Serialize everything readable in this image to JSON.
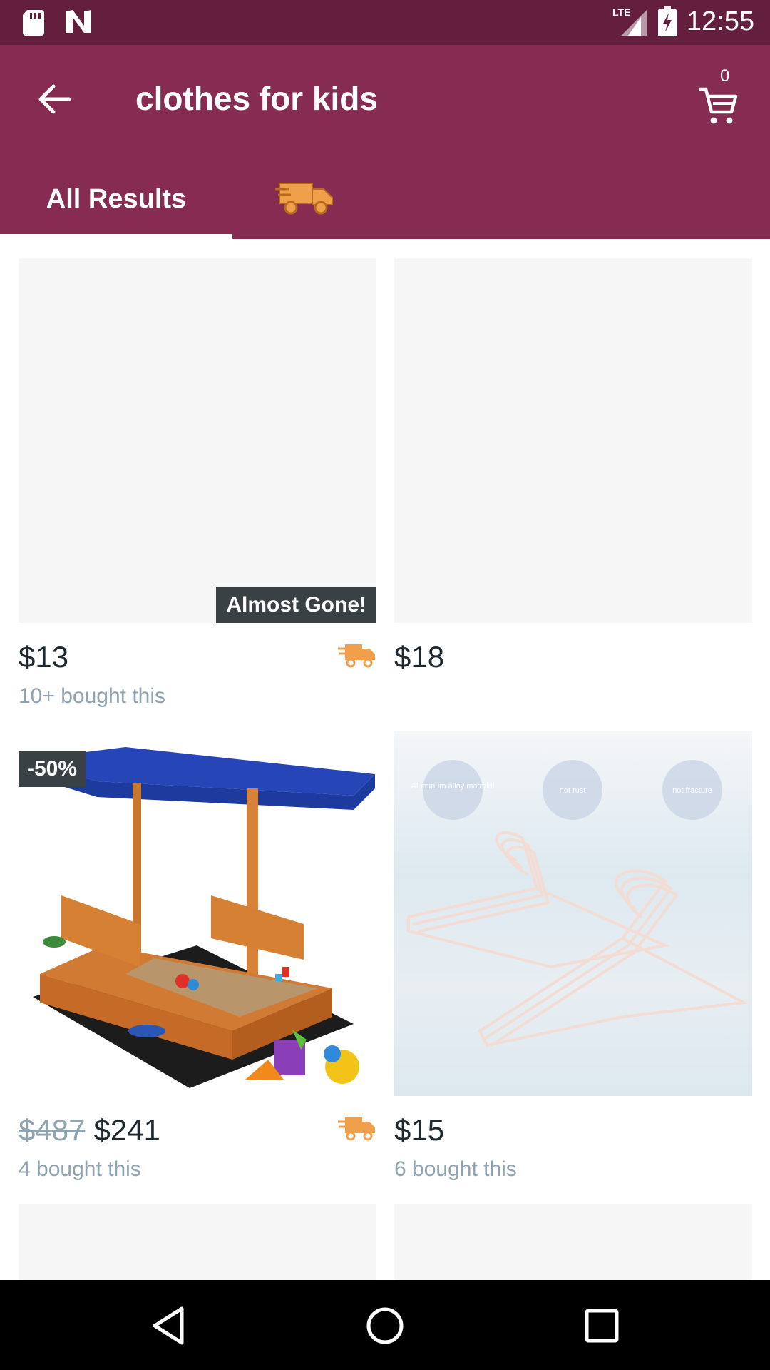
{
  "status_bar": {
    "time": "12:55",
    "network": "LTE"
  },
  "header": {
    "title": "clothes for kids",
    "cart_count": "0",
    "background": "#862b51",
    "status_background": "#641f3f"
  },
  "tabs": [
    {
      "label": "All Results",
      "selected": true
    },
    {
      "label": "",
      "icon": "fast-delivery-truck-icon",
      "selected": false
    }
  ],
  "products": [
    {
      "price": "$13",
      "old_price": "",
      "bought": "10+ bought this",
      "badge": "Almost Gone!",
      "fast_shipping": true
    },
    {
      "price": "$18",
      "old_price": "",
      "bought": "",
      "badge": "",
      "fast_shipping": false
    },
    {
      "price": "$241",
      "old_price": "$487",
      "bought": "4 bought this",
      "badge": "-50%",
      "fast_shipping": true
    },
    {
      "price": "$15",
      "old_price": "",
      "bought": "6 bought this",
      "badge": "",
      "fast_shipping": false,
      "image_labels": [
        "Aluminum alloy material",
        "not rust",
        "not fracture"
      ]
    }
  ],
  "colors": {
    "accent_orange": "#f0a04b",
    "badge_dark": "#3a4145"
  }
}
